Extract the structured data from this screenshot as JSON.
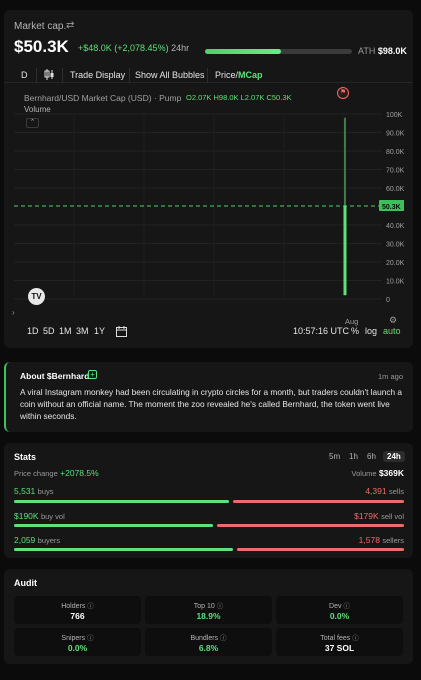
{
  "header": {
    "label": "Market cap.",
    "swap_icon": "swap-icon",
    "value": "$50.3K",
    "change": "+$48.0K (+2,078.45%)",
    "change_period": "24hr",
    "ath_progress": 0.52,
    "ath_label": "ATH",
    "ath_value": "$98.0K"
  },
  "toolbar": {
    "interval": "D",
    "candle_icon": "candlestick-icon",
    "trade_display": "Trade Display",
    "show_bubbles": "Show All Bubbles",
    "price_label": "Price",
    "mcap_label": "MCap"
  },
  "chart_data": {
    "type": "line",
    "title": "Bernhard/USD Market Cap (USD) · Pump",
    "ohlc": "O2.07K H98.0K L2.07K C50.3K",
    "volume_label": "Volume",
    "y_ticks": [
      "100K",
      "90.0K",
      "80.0K",
      "70.0K",
      "60.0K",
      "50.3K",
      "40.0K",
      "30.0K",
      "20.0K",
      "10.0K",
      "0"
    ],
    "ylim": [
      0,
      100000
    ],
    "current": 50300,
    "current_label": "50.3K",
    "x_label": "Aug",
    "candle": {
      "open": 2070,
      "high": 98000,
      "low": 2070,
      "close": 50300
    },
    "grid": true
  },
  "bottombar": {
    "ranges": [
      "1D",
      "5D",
      "1M",
      "3M",
      "1Y"
    ],
    "time": "10:57:16 UTC",
    "percent": "%",
    "log": "log",
    "auto": "auto"
  },
  "about": {
    "title": "About $Bernhard",
    "time": "1m ago",
    "text": "A viral Instagram monkey had been circulating in crypto circles for a month, but traders couldn't launch a coin without an official name. The moment the zoo revealed he's called Bernhard, the token went live within seconds."
  },
  "stats": {
    "title": "Stats",
    "timeframes": [
      "5m",
      "1h",
      "6h",
      "24h"
    ],
    "active_timeframe": "24h",
    "price_change_label": "Price change",
    "price_change": "+2078.5%",
    "volume_label": "Volume",
    "volume": "$369K",
    "buys": "5,531",
    "buys_label": "buys",
    "sells": "4,391",
    "sells_label": "sells",
    "buys_share": 0.557,
    "buy_vol": "$190K",
    "buy_vol_label": "buy vol",
    "sell_vol": "$179K",
    "sell_vol_label": "sell vol",
    "buy_vol_share": 0.515,
    "buyers": "2,059",
    "buyers_label": "buyers",
    "sellers": "1,578",
    "sellers_label": "sellers",
    "buyers_share": 0.566
  },
  "audit": {
    "title": "Audit",
    "cells": [
      {
        "label": "Holders",
        "value": "766"
      },
      {
        "label": "Top 10",
        "value": "18.9%"
      },
      {
        "label": "Dev",
        "value": "0.0%"
      },
      {
        "label": "Snipers",
        "value": "0.0%"
      },
      {
        "label": "Bundlers",
        "value": "6.8%"
      },
      {
        "label": "Total fees",
        "value": "37 SOL"
      }
    ]
  },
  "colors": {
    "green": "#5ee07a",
    "red": "#ef6a6a",
    "background": "#0b0b0b",
    "card": "#161616"
  }
}
